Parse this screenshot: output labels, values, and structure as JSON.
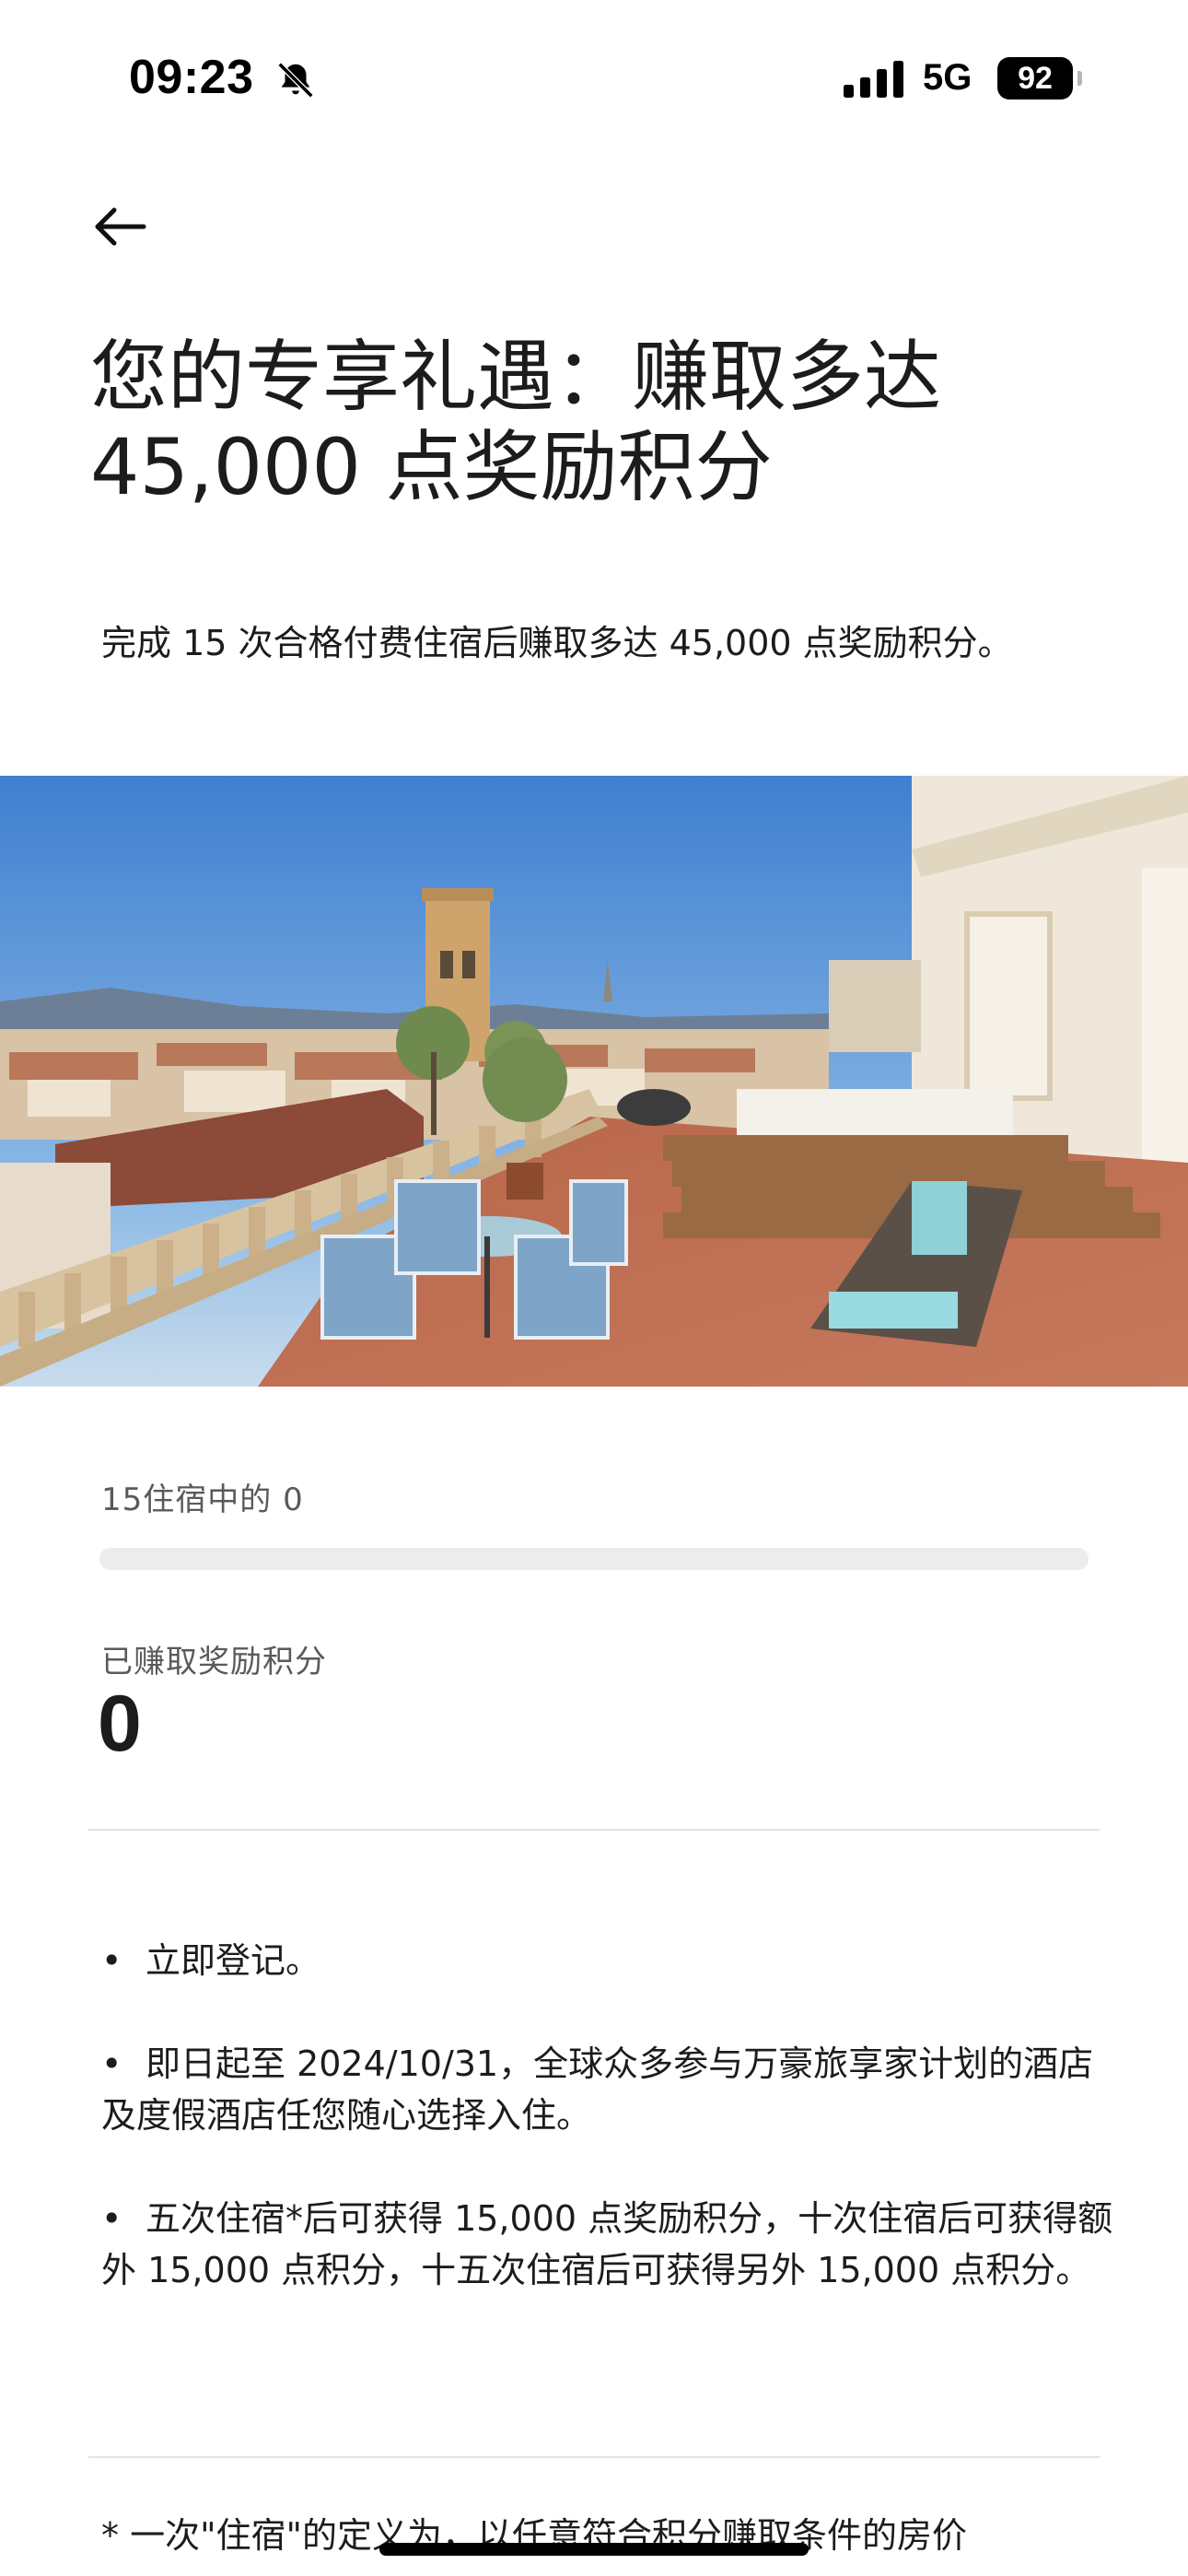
{
  "status_bar": {
    "time": "09:23",
    "network": "5G",
    "battery": "92",
    "icons": [
      "bell-muted-icon",
      "signal-icon"
    ]
  },
  "nav": {
    "back_icon": "arrow-left-icon"
  },
  "header": {
    "title": "您的专享礼遇：赚取多达 45,000 点奖励积分",
    "subtitle": "完成 15 次合格付费住宿后赚取多达 45,000 点奖励积分。"
  },
  "hero": {
    "image": "rooftop-terrace-photo"
  },
  "progress": {
    "stays_label": "15住宿中的 0",
    "stays_completed": 0,
    "stays_total": 15,
    "fraction": 0,
    "earned_label": "已赚取奖励积分",
    "earned_value": "0"
  },
  "details": {
    "bullet_symbol": "•",
    "items": [
      "立即登记。",
      "即日起至 2024/10/31，全球众多参与万豪旅享家计划的酒店及度假酒店任您随心选择入住。",
      "五次住宿*后可获得 15,000 点奖励积分，十次住宿后可获得额外 15,000 点积分，十五次住宿后可获得另外 15,000 点积分。"
    ]
  },
  "footnote": {
    "text": "* 一次\"住宿\"的定义为，以任意符合积分赚取条件的房价"
  },
  "colors": {
    "text": "#1c1c1c",
    "muted": "#5a5a5a",
    "track": "#ececec",
    "divider": "#e3e3e3"
  }
}
